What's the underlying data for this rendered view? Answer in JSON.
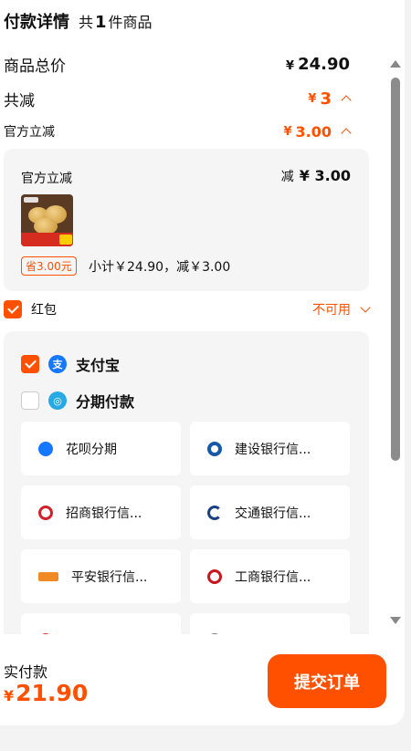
{
  "header": {
    "title": "付款详情",
    "count_prefix": "共",
    "count": "1",
    "count_suffix": "件商品"
  },
  "summary": {
    "total_label": "商品总价",
    "total_currency": "¥",
    "total_value": "24.90",
    "discount_label": "共减",
    "discount_currency": "¥",
    "discount_value": "3",
    "official_label": "官方立减",
    "official_currency": "¥",
    "official_value": "3.00"
  },
  "discount_card": {
    "title": "官方立减",
    "minus_label": "减",
    "currency": "¥",
    "value": "3.00",
    "save_badge": "省3.00元",
    "subtotal_text": "小计￥24.90，减￥3.00"
  },
  "red_packet": {
    "label": "红包",
    "status": "不可用",
    "checked": true
  },
  "payment": {
    "options": [
      {
        "name": "支付宝",
        "icon": "alipay-icon",
        "checked": true
      },
      {
        "name": "分期付款",
        "icon": "installment-icon",
        "checked": false
      }
    ],
    "banks": [
      {
        "name": "花呗分期",
        "icon": "huabei-icon"
      },
      {
        "name": "建设银行信...",
        "icon": "ccb-icon"
      },
      {
        "name": "招商银行信...",
        "icon": "cmb-icon"
      },
      {
        "name": "交通银行信...",
        "icon": "bocom-icon"
      },
      {
        "name": "平安银行信...",
        "icon": "pingan-icon"
      },
      {
        "name": "工商银行信...",
        "icon": "icbc-icon"
      }
    ]
  },
  "footer": {
    "pay_label": "实付款",
    "currency": "¥",
    "pay_value": "21.90",
    "submit_label": "提交订单"
  },
  "colors": {
    "accent": "#ff5000",
    "card_bg": "#f5f5f5"
  }
}
